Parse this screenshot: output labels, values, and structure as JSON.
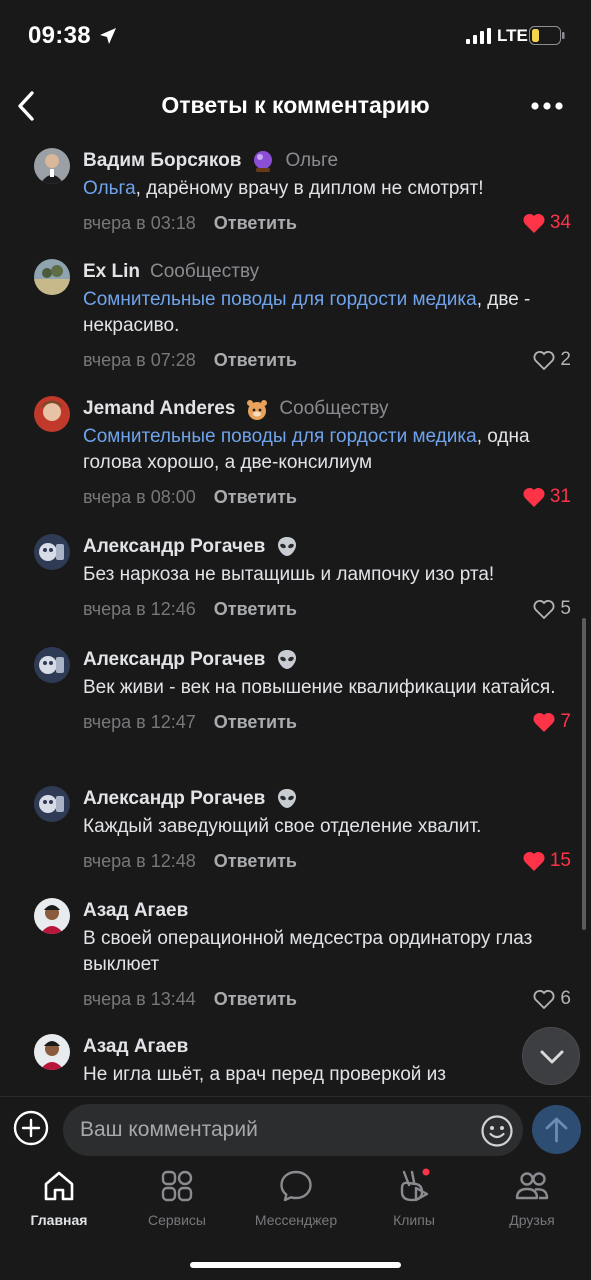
{
  "status_bar": {
    "time": "09:38",
    "network": "LTE",
    "location-icon": "location-arrow-icon",
    "battery_level": 0.2,
    "battery_color": "#f6d64a"
  },
  "header": {
    "title": "Ответы к комментарию",
    "back_icon": "chevron-left-icon",
    "more_icon": "more-horizontal-icon"
  },
  "comments": [
    {
      "author": "Вадим Борсяков",
      "emoji": "crystal-ball-icon",
      "reply_to": "Ольге",
      "mention": "Ольга",
      "text": ", дарёному врачу в диплом не смотрят!",
      "date": "вчера в 03:18",
      "reply_label": "Ответить",
      "likes": "34",
      "liked": true
    },
    {
      "author": "Ex Lin",
      "emoji": "",
      "reply_to": "Сообществу",
      "mention": "Сомнительные поводы для гордости медика",
      "text": ", две - некрасиво.",
      "date": "вчера в 07:28",
      "reply_label": "Ответить",
      "likes": "2",
      "liked": false
    },
    {
      "author": "Jemand Anderes",
      "emoji": "hamster-icon",
      "reply_to": "Сообществу",
      "mention": "Сомнительные поводы для гордости медика",
      "text": ", одна голова хорошо, а две-консилиум",
      "date": "вчера в 08:00",
      "reply_label": "Ответить",
      "likes": "31",
      "liked": true
    },
    {
      "author": "Александр Рогачев",
      "emoji": "alien-icon",
      "reply_to": "",
      "mention": "",
      "text": "Без наркоза не вытащишь и лампочку изо рта!",
      "date": "вчера в 12:46",
      "reply_label": "Ответить",
      "likes": "5",
      "liked": false
    },
    {
      "author": "Александр Рогачев",
      "emoji": "alien-icon",
      "reply_to": "",
      "mention": "",
      "text": "Век живи - век на повышение квалификации катайся.",
      "date": "вчера в 12:47",
      "reply_label": "Ответить",
      "likes": "7",
      "liked": true
    },
    {
      "author": "Александр Рогачев",
      "emoji": "alien-icon",
      "reply_to": "",
      "mention": "",
      "text": "Каждый заведующий свое отделение хвалит.",
      "date": "вчера в 12:48",
      "reply_label": "Ответить",
      "likes": "15",
      "liked": true
    },
    {
      "author": "Азад Агаев",
      "emoji": "",
      "reply_to": "",
      "mention": "",
      "text": "В своей операционной медсестра ординатору глаз выклюет",
      "date": "вчера в 13:44",
      "reply_label": "Ответить",
      "likes": "6",
      "liked": false
    },
    {
      "author": "Азад Агаев",
      "emoji": "",
      "reply_to": "",
      "mention": "",
      "text": "Не игла шьёт, а врач перед проверкой из",
      "date": "",
      "reply_label": "",
      "likes": "",
      "liked": false
    }
  ],
  "input": {
    "placeholder": "Ваш комментарий",
    "add_icon": "plus-circle-icon",
    "emoji_icon": "smile-icon",
    "send_icon": "arrow-up-icon"
  },
  "tabs": [
    {
      "label": "Главная",
      "icon": "home-icon",
      "active": true
    },
    {
      "label": "Сервисы",
      "icon": "services-grid-icon",
      "active": false
    },
    {
      "label": "Мессенджер",
      "icon": "chat-bubble-icon",
      "active": false
    },
    {
      "label": "Клипы",
      "icon": "clips-icon",
      "active": false,
      "badge": true
    },
    {
      "label": "Друзья",
      "icon": "friends-icon",
      "active": false
    }
  ],
  "colors": {
    "background": "#19191a",
    "text": "#e1e3e6",
    "mention": "#6fa3eb",
    "like_active": "#ff3347",
    "secondary": "#76787a"
  }
}
